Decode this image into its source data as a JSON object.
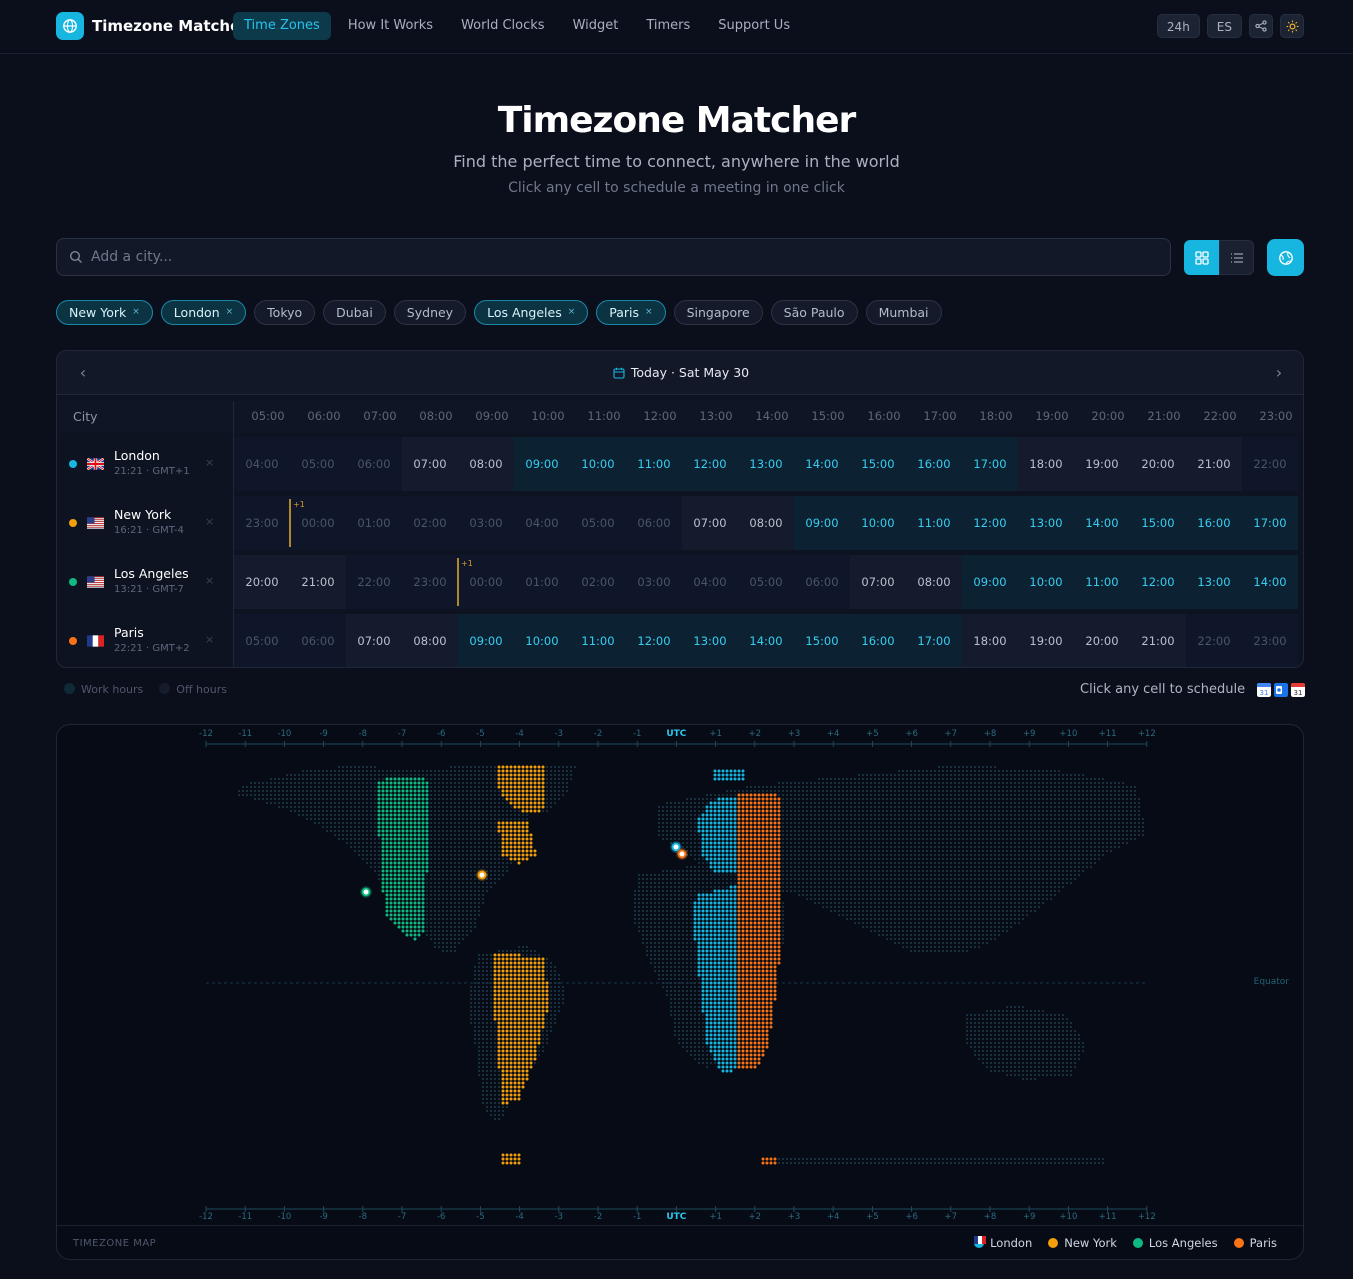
{
  "app": {
    "name": "Timezone Matcher"
  },
  "nav": {
    "links": [
      "Time Zones",
      "How It Works",
      "World Clocks",
      "Widget",
      "Timers",
      "Support Us"
    ],
    "format_label": "24h",
    "lang_label": "ES"
  },
  "hero": {
    "title": "Timezone Matcher",
    "subtitle": "Find the perfect time to connect, anywhere in the world",
    "hint": "Click any cell to schedule a meeting in one click"
  },
  "search": {
    "placeholder": "Add a city..."
  },
  "chips": [
    {
      "label": "New York",
      "selected": true
    },
    {
      "label": "London",
      "selected": true
    },
    {
      "label": "Tokyo",
      "selected": false
    },
    {
      "label": "Dubai",
      "selected": false
    },
    {
      "label": "Sydney",
      "selected": false
    },
    {
      "label": "Los Angeles",
      "selected": true
    },
    {
      "label": "Paris",
      "selected": true
    },
    {
      "label": "Singapore",
      "selected": false
    },
    {
      "label": "São Paulo",
      "selected": false
    },
    {
      "label": "Mumbai",
      "selected": false
    }
  ],
  "chip_remove": "×",
  "schedule": {
    "date_label": "Today · Sat May 30",
    "city_header": "City",
    "hours": [
      "05:00",
      "06:00",
      "07:00",
      "08:00",
      "09:00",
      "10:00",
      "11:00",
      "12:00",
      "13:00",
      "14:00",
      "15:00",
      "16:00",
      "17:00",
      "18:00",
      "19:00",
      "20:00",
      "21:00",
      "22:00",
      "23:00"
    ],
    "day_plus": "+1",
    "remove_glyph": "×",
    "rows": [
      {
        "city": "London",
        "meta": "21:21 · GMT+1",
        "dot": "#16b6e0",
        "flag": "gb",
        "times": [
          "04:00",
          "05:00",
          "06:00",
          "07:00",
          "08:00",
          "09:00",
          "10:00",
          "11:00",
          "12:00",
          "13:00",
          "14:00",
          "15:00",
          "16:00",
          "17:00",
          "18:00",
          "19:00",
          "20:00",
          "21:00",
          "22:00"
        ],
        "states": [
          "off",
          "off",
          "off",
          "mid",
          "mid",
          "work",
          "work",
          "work",
          "work",
          "work",
          "work",
          "work",
          "work",
          "work",
          "mid",
          "mid",
          "mid",
          "mid",
          "off"
        ],
        "day_break": null
      },
      {
        "city": "New York",
        "meta": "16:21 · GMT-4",
        "dot": "#f59e0b",
        "flag": "us",
        "times": [
          "23:00",
          "00:00",
          "01:00",
          "02:00",
          "03:00",
          "04:00",
          "05:00",
          "06:00",
          "07:00",
          "08:00",
          "09:00",
          "10:00",
          "11:00",
          "12:00",
          "13:00",
          "14:00",
          "15:00",
          "16:00",
          "17:00"
        ],
        "states": [
          "off",
          "off",
          "off",
          "off",
          "off",
          "off",
          "off",
          "off",
          "mid",
          "mid",
          "work",
          "work",
          "work",
          "work",
          "work",
          "work",
          "work",
          "work",
          "work"
        ],
        "day_break": 1
      },
      {
        "city": "Los Angeles",
        "meta": "13:21 · GMT-7",
        "dot": "#10b981",
        "flag": "us",
        "times": [
          "20:00",
          "21:00",
          "22:00",
          "23:00",
          "00:00",
          "01:00",
          "02:00",
          "03:00",
          "04:00",
          "05:00",
          "06:00",
          "07:00",
          "08:00",
          "09:00",
          "10:00",
          "11:00",
          "12:00",
          "13:00",
          "14:00"
        ],
        "states": [
          "mid",
          "mid",
          "off",
          "off",
          "off",
          "off",
          "off",
          "off",
          "off",
          "off",
          "off",
          "mid",
          "mid",
          "work",
          "work",
          "work",
          "work",
          "work",
          "work"
        ],
        "day_break": 4
      },
      {
        "city": "Paris",
        "meta": "22:21 · GMT+2",
        "dot": "#f97316",
        "flag": "fr",
        "times": [
          "05:00",
          "06:00",
          "07:00",
          "08:00",
          "09:00",
          "10:00",
          "11:00",
          "12:00",
          "13:00",
          "14:00",
          "15:00",
          "16:00",
          "17:00",
          "18:00",
          "19:00",
          "20:00",
          "21:00",
          "22:00",
          "23:00"
        ],
        "states": [
          "off",
          "off",
          "mid",
          "mid",
          "work",
          "work",
          "work",
          "work",
          "work",
          "work",
          "work",
          "work",
          "work",
          "mid",
          "mid",
          "mid",
          "mid",
          "off",
          "off"
        ],
        "day_break": null
      }
    ]
  },
  "legend": {
    "work_hours": "Work hours",
    "off_hours": "Off hours",
    "schedule_hint": "Click any cell to schedule"
  },
  "map": {
    "title": "TIMEZONE MAP",
    "equator_label": "Equator",
    "offsets": [
      "-12",
      "-11",
      "-10",
      "-9",
      "-8",
      "-7",
      "-6",
      "-5",
      "-4",
      "-3",
      "-2",
      "-1",
      "UTC",
      "+1",
      "+2",
      "+3",
      "+4",
      "+5",
      "+6",
      "+7",
      "+8",
      "+9",
      "+10",
      "+11",
      "+12"
    ],
    "legend": [
      {
        "label": "London",
        "color": "#16b6e0",
        "flag": "gb"
      },
      {
        "label": "New York",
        "color": "#f59e0b",
        "flag": "us"
      },
      {
        "label": "Los Angeles",
        "color": "#10b981",
        "flag": "us"
      },
      {
        "label": "Paris",
        "color": "#f97316",
        "flag": "fr"
      }
    ]
  },
  "colors": {
    "accent": "#16b6e0",
    "new_york": "#f59e0b",
    "los_angeles": "#10b981",
    "paris": "#f97316"
  }
}
